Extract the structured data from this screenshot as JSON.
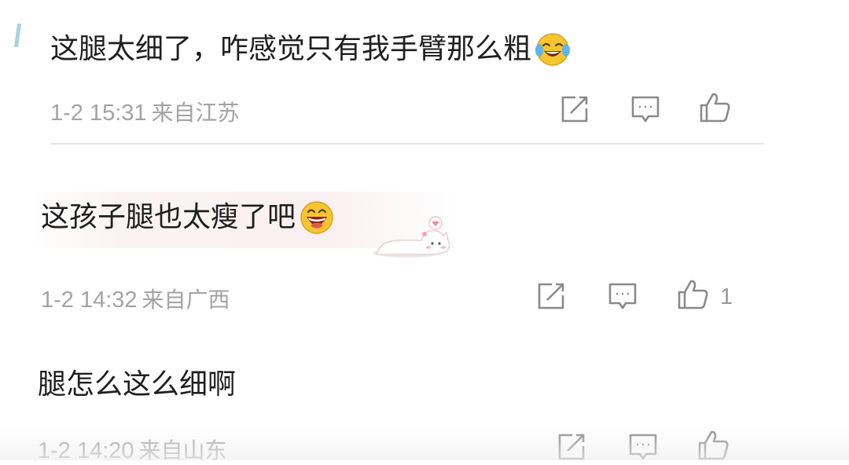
{
  "comments": [
    {
      "text": "这腿太细了，咋感觉只有我手臂那么粗",
      "emoji": "laughing-tears-emoji",
      "time": "1-2 15:31",
      "region": "来自江苏",
      "likes": ""
    },
    {
      "text": "这孩子腿也太瘦了吧",
      "emoji": "grinning-emoji",
      "time": "1-2 14:32",
      "region": "来自广西",
      "likes": "1"
    },
    {
      "text": "腿怎么这么细啊",
      "emoji": "",
      "time": "1-2 14:20",
      "region": "来自山东",
      "likes": ""
    }
  ],
  "icons": {
    "share": "share-icon",
    "reply": "comment-icon",
    "like": "thumbs-up-icon",
    "cat_sticker": "cat-sticker-icon"
  },
  "colors": {
    "text": "#1f1f1f",
    "meta": "#a3a3a3",
    "icon": "#8a8a8a",
    "divider": "#e6e6e6",
    "accent": "#a7d3e1"
  }
}
